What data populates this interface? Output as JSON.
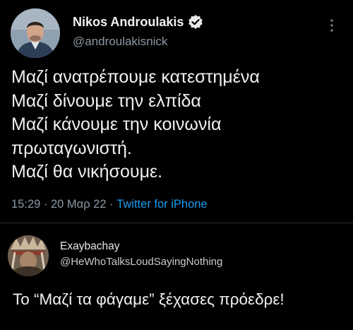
{
  "tweet": {
    "author_name": "Nikos Androulakis",
    "author_handle": "@androulakisnick",
    "lines": [
      "Μαζί ανατρέπουμε κατεστημένα",
      "Μαζί δίνουμε την ελπίδα",
      "Μαζί κάνουμε την κοινωνία",
      "πρωταγωνιστή.",
      "Μαζί θα νικήσουμε."
    ],
    "time": "15:29",
    "date": "20 Μαρ 22",
    "source": "Twitter for iPhone",
    "icons": {
      "verified": "verified-badge-icon",
      "more": "more-vertical-icon"
    }
  },
  "reply": {
    "author_name": "Exaybachay",
    "author_handle": "@HeWhoTalksLoudSayingNothing",
    "text": "Το “Μαζί τα φάγαμε” ξέχασες πρόεδρε!"
  },
  "colors": {
    "background": "#000000",
    "text_primary": "#e7e9ea",
    "text_secondary": "#8b98a5",
    "link": "#1d9bf0",
    "divider": "#2f3336"
  }
}
